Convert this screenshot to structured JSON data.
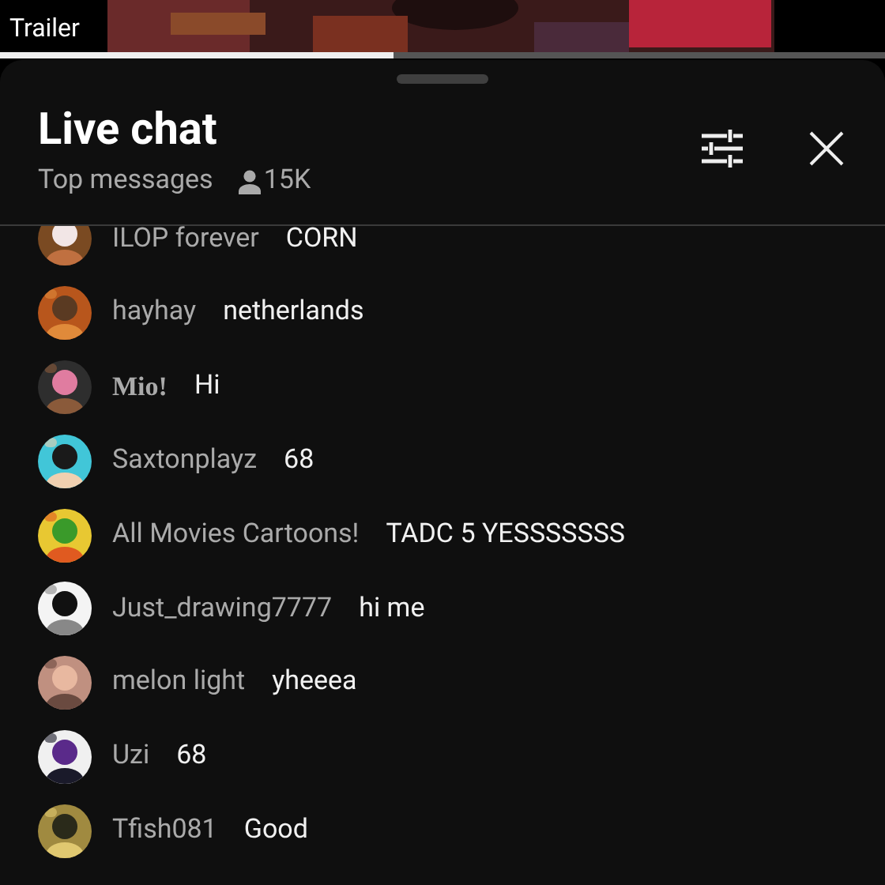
{
  "video": {
    "label": "Trailer",
    "progress": {
      "level": 0.445
    }
  },
  "header": {
    "title": "Live chat",
    "mode": "Top messages",
    "viewers": "15K"
  },
  "messages": [
    {
      "author": "ILOP forever",
      "text": "CORN",
      "serif_name": false
    },
    {
      "author": "hayhay",
      "text": "netherlands",
      "serif_name": false
    },
    {
      "author": "Mio!",
      "text": "Hi",
      "serif_name": true
    },
    {
      "author": "Saxtonplayz",
      "text": "68",
      "serif_name": false
    },
    {
      "author": "All Movies Cartoons!",
      "text": "TADC 5 YESSSSSSS",
      "serif_name": false
    },
    {
      "author": "Just_drawing7777",
      "text": "hi me",
      "serif_name": false
    },
    {
      "author": "melon light",
      "text": "yheeea",
      "serif_name": false
    },
    {
      "author": "Uzi",
      "text": "68",
      "serif_name": false
    },
    {
      "author": "Tfish081",
      "text": "Good",
      "serif_name": false
    }
  ]
}
